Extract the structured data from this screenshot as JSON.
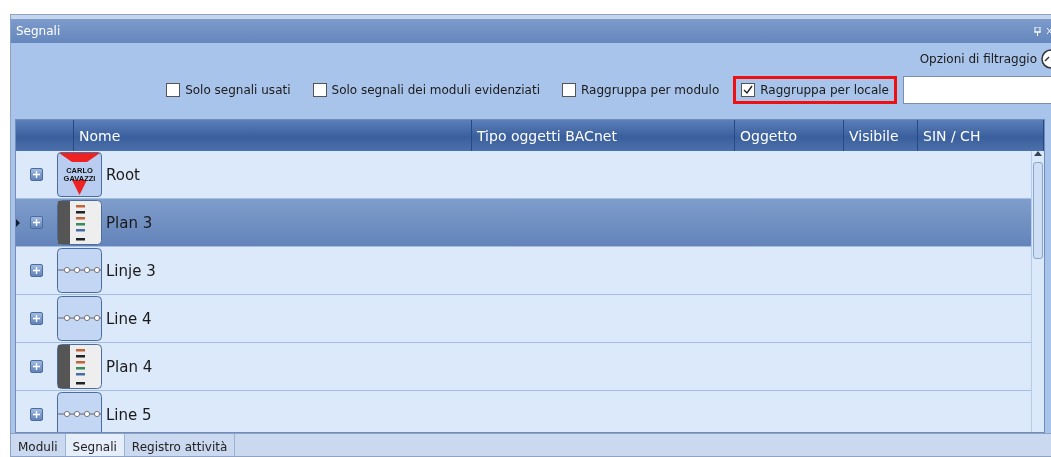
{
  "panel": {
    "title": "Segnali"
  },
  "filter_options": {
    "label": "Opzioni di filtraggio"
  },
  "filters": [
    {
      "label": "Solo segnali usati",
      "checked": false,
      "highlighted": false
    },
    {
      "label": "Solo segnali dei moduli evidenziati",
      "checked": false,
      "highlighted": false
    },
    {
      "label": "Raggruppa per modulo",
      "checked": false,
      "highlighted": false
    },
    {
      "label": "Raggruppa per locale",
      "checked": true,
      "highlighted": true
    }
  ],
  "table": {
    "columns": [
      "Nome",
      "Tipo oggetti BACnet",
      "Oggetto",
      "Visibile",
      "SIN / CH"
    ],
    "rows": [
      {
        "name": "Root",
        "kind": "root",
        "logo_text": "CARLO GAVAZZI",
        "selected": false
      },
      {
        "name": "Plan 3",
        "kind": "floor",
        "selected": true
      },
      {
        "name": "Linje 3",
        "kind": "line",
        "selected": false
      },
      {
        "name": "Line 4",
        "kind": "line",
        "selected": false
      },
      {
        "name": "Plan 4",
        "kind": "floor",
        "selected": false
      },
      {
        "name": "Line 5",
        "kind": "line",
        "selected": false
      }
    ]
  },
  "bottom_tabs": [
    {
      "label": "Moduli",
      "selected": false
    },
    {
      "label": "Segnali",
      "selected": true
    },
    {
      "label": "Registro attività",
      "selected": false
    }
  ]
}
